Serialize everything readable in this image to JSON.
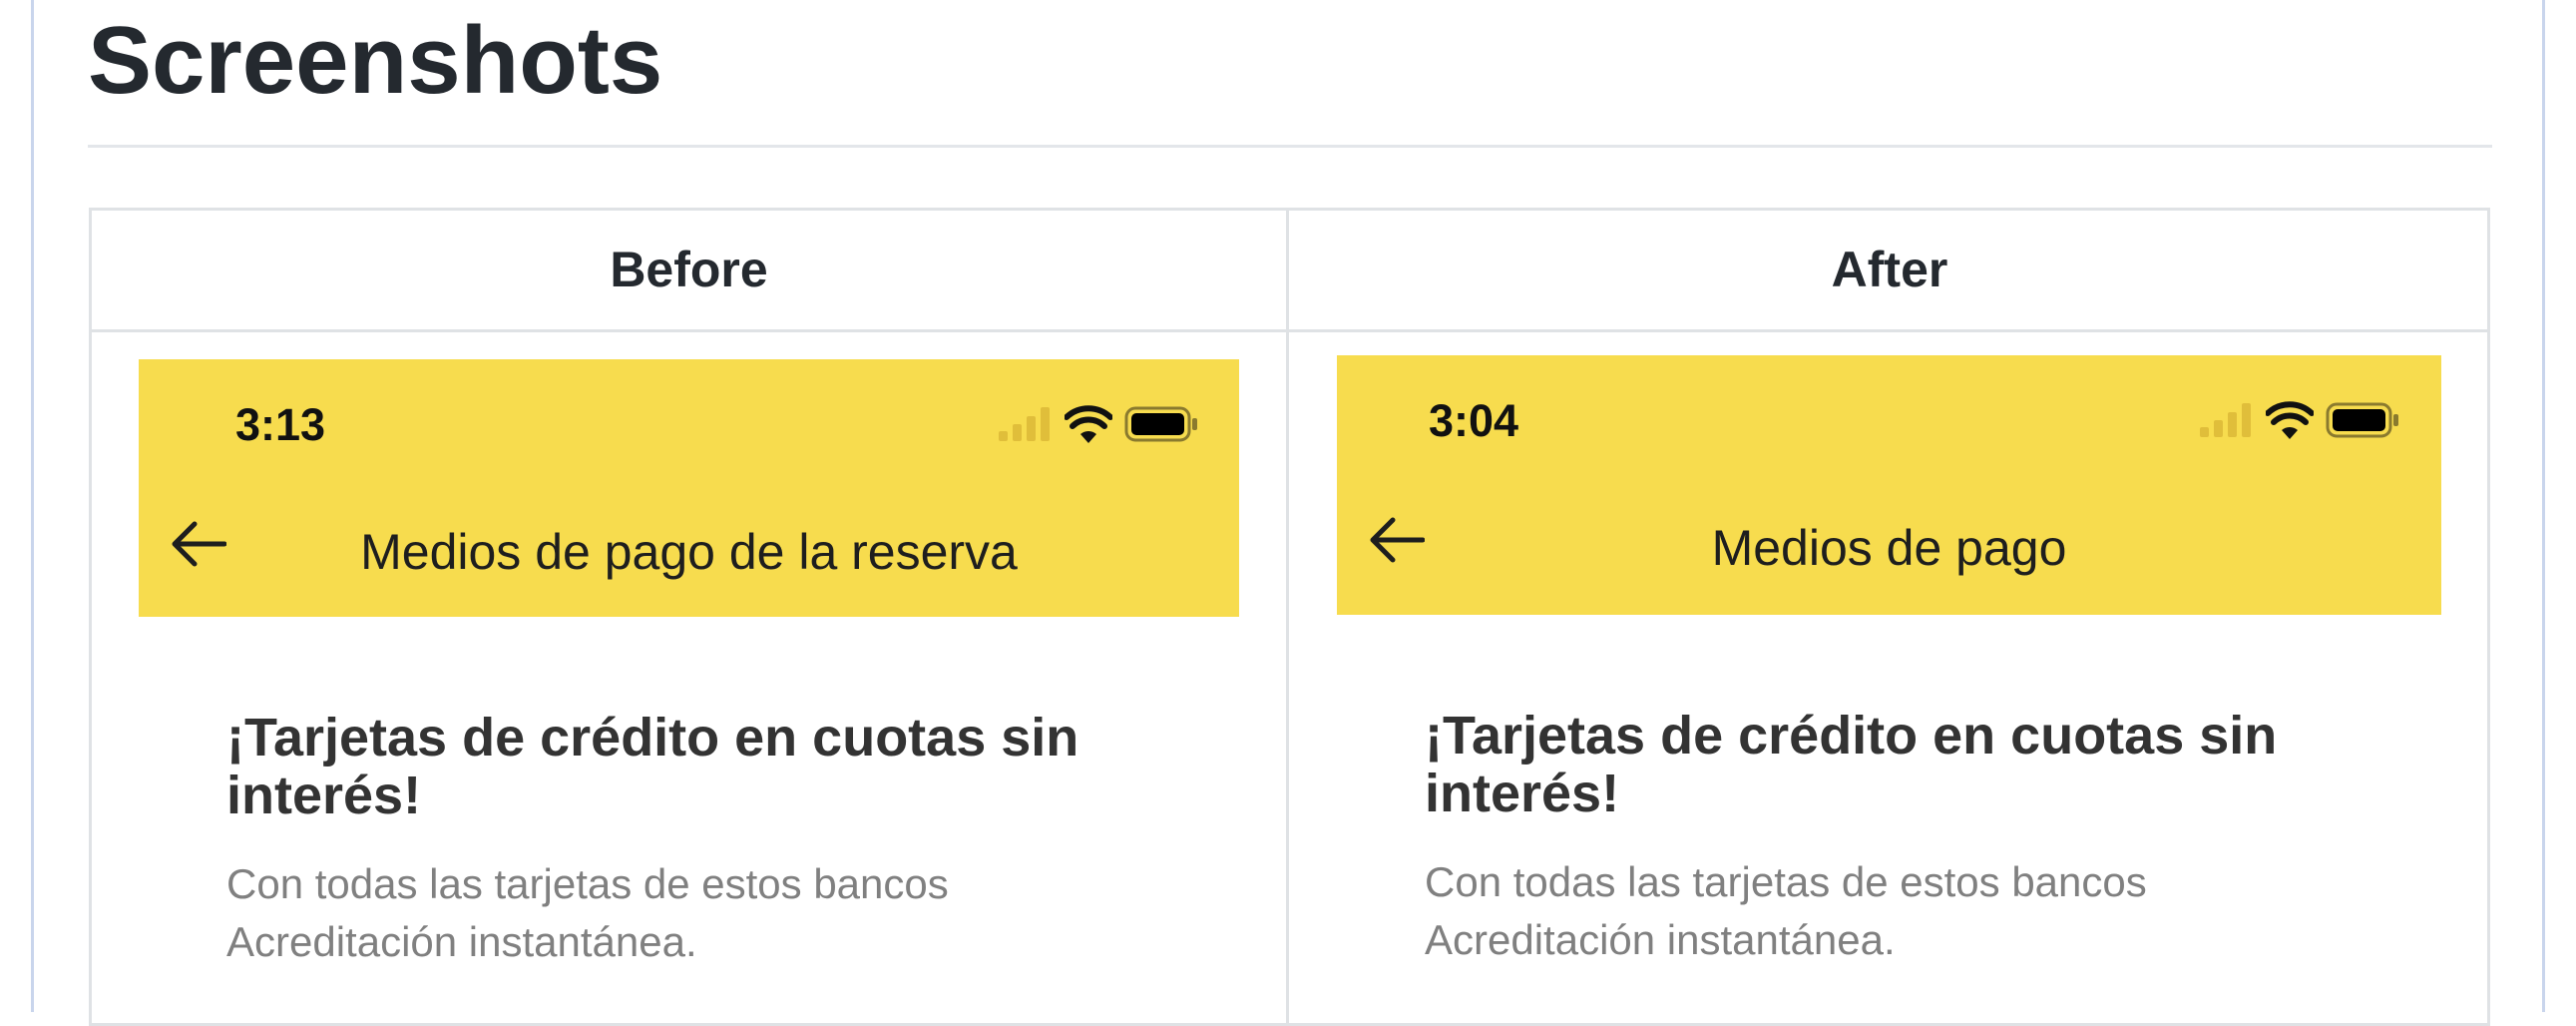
{
  "heading": "Screenshots",
  "columns": [
    {
      "header": "Before",
      "status_time": "3:13",
      "nav_title": "Medios de pago de la reserva",
      "promo_title": "¡Tarjetas de crédito en cuotas sin interés!",
      "promo_line1": "Con todas las tarjetas de estos bancos",
      "promo_line2": "Acreditación instantánea."
    },
    {
      "header": "After",
      "status_time": "3:04",
      "nav_title": "Medios de pago",
      "promo_title": "¡Tarjetas de crédito en cuotas sin interés!",
      "promo_line1": "Con todas las tarjetas de estos bancos",
      "promo_line2": "Acreditación instantánea."
    }
  ],
  "icons": {
    "signal": "cellular-signal-icon",
    "wifi": "wifi-icon",
    "battery": "battery-icon",
    "back": "back-arrow-icon"
  },
  "colors": {
    "app_bar": "#f7dc4e",
    "heading": "#24292f",
    "promo_title": "#333333",
    "promo_sub": "#808080"
  }
}
